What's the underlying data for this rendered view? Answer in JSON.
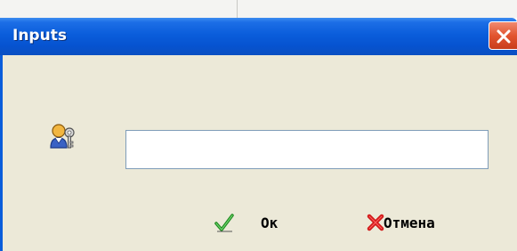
{
  "dialog": {
    "title": "Inputs",
    "input": {
      "value": "",
      "placeholder": ""
    },
    "ok_label": "Ок",
    "cancel_label": "Отмена"
  },
  "icons": {
    "user": "user-key-icon",
    "ok": "green-check-icon",
    "cancel": "red-x-icon",
    "close": "close-icon"
  },
  "colors": {
    "titlebar": "#0a5ddb",
    "body": "#ece9d8",
    "close": "#e2542f"
  }
}
